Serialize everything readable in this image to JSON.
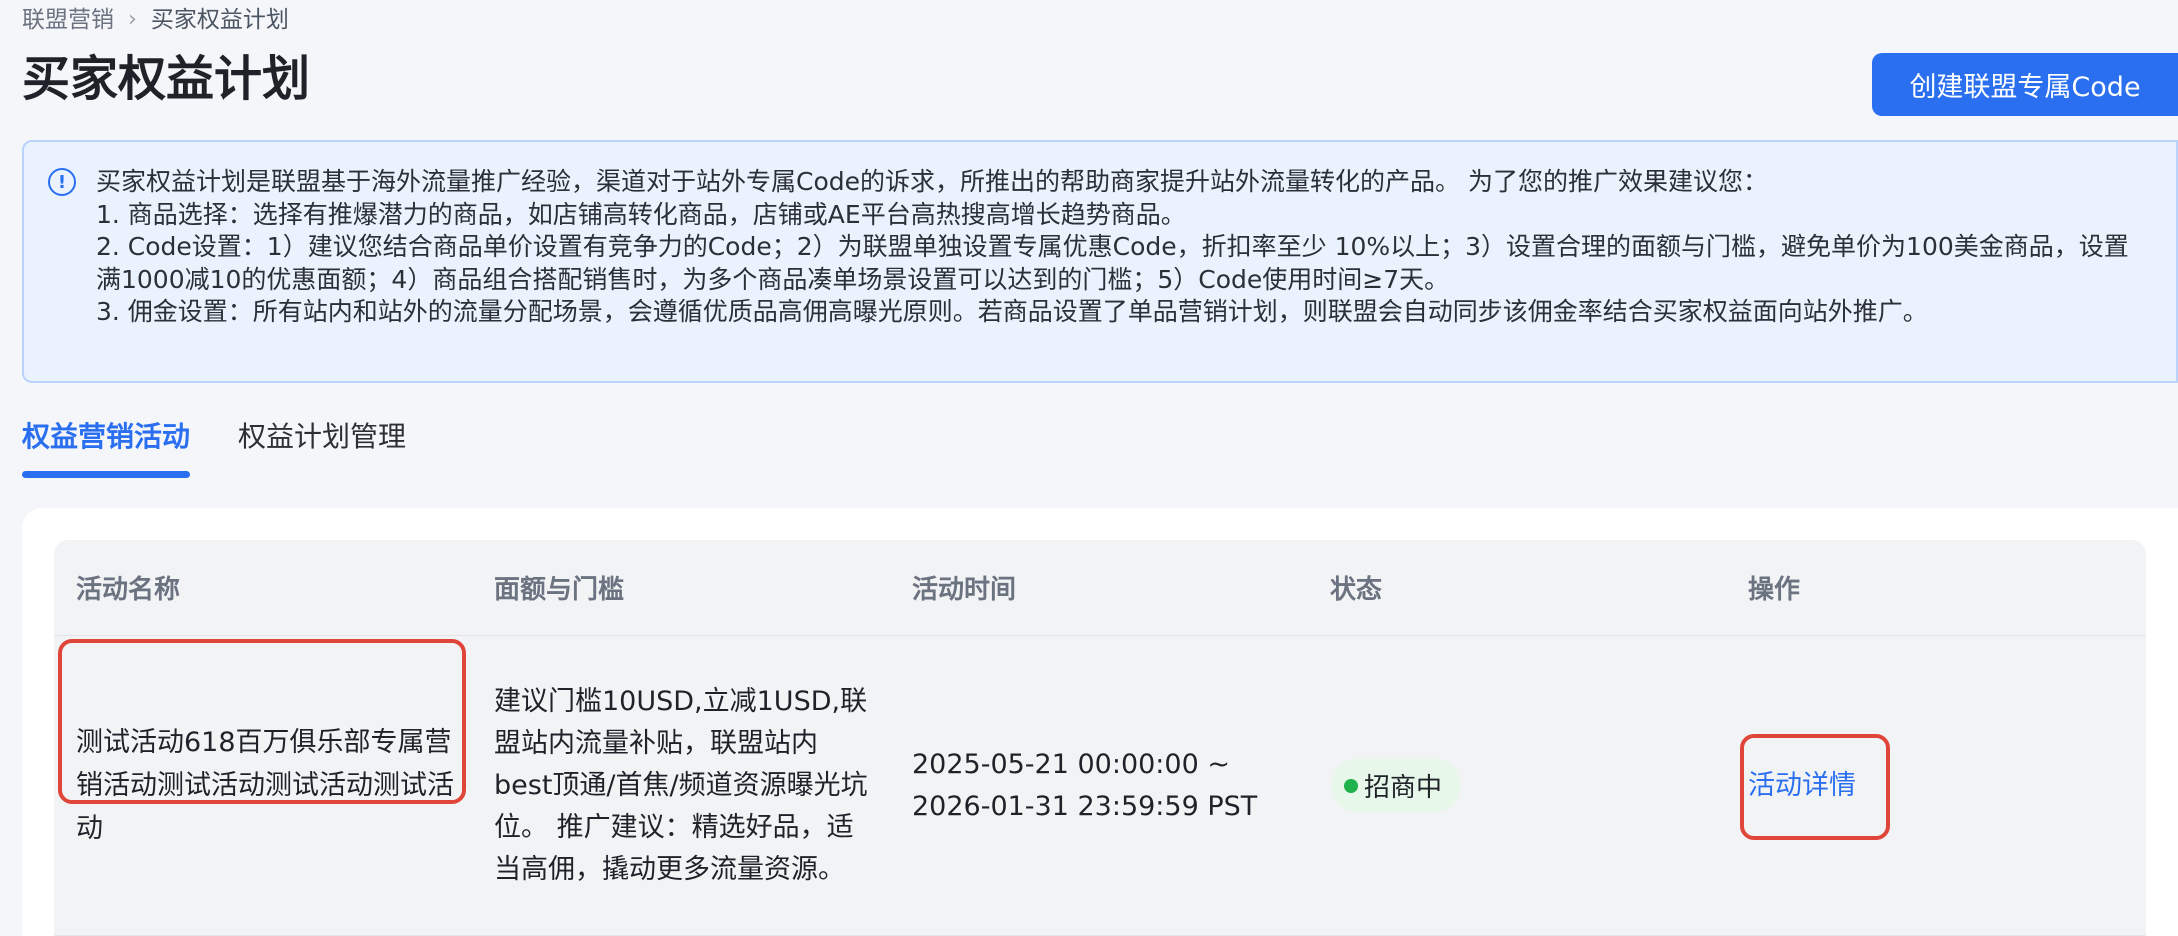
{
  "breadcrumb": {
    "parent": "联盟营销",
    "separator": "›",
    "current": "买家权益计划"
  },
  "header": {
    "title": "买家权益计划",
    "create_button": "创建联盟专属Code"
  },
  "alert": {
    "icon": "info-icon",
    "lines": [
      "买家权益计划是联盟基于海外流量推广经验，渠道对于站外专属Code的诉求，所推出的帮助商家提升站外流量转化的产品。 为了您的推广效果建议您：",
      "1. 商品选择：选择有推爆潜力的商品，如店铺高转化商品，店铺或AE平台高热搜高增长趋势商品。",
      "2. Code设置：1）建议您结合商品单价设置有竞争力的Code；2）为联盟单独设置专属优惠Code，折扣率至少 10%以上；3）设置合理的面额与门槛，避免单价为100美金商品，设置满1000减10的优惠面额；4）商品组合搭配销售时，为多个商品凑单场景设置可以达到的门槛；5）Code使用时间≥7天。",
      "3. 佣金设置：所有站内和站外的流量分配场景，会遵循优质品高佣高曝光原则。若商品设置了单品营销计划，则联盟会自动同步该佣金率结合买家权益面向站外推广。"
    ]
  },
  "tabs": [
    {
      "label": "权益营销活动",
      "active": true
    },
    {
      "label": "权益计划管理",
      "active": false
    }
  ],
  "table": {
    "columns": [
      "活动名称",
      "面额与门槛",
      "活动时间",
      "状态",
      "操作"
    ],
    "rows": [
      {
        "name": "测试活动618百万俱乐部专属营销活动测试活动测试活动测试活动",
        "threshold": "建议门槛10USD,立减1USD,联盟站内流量补贴，联盟站内best顶通/首焦/频道资源曝光坑位。 推广建议：精选好品，适当高佣，撬动更多流量资源。",
        "time_start": "2025-05-21 00:00:00 ~",
        "time_end": "2026-01-31 23:59:59 PST",
        "status": "招商中",
        "action": "活动详情"
      }
    ]
  },
  "colors": {
    "accent": "#2a6ff0",
    "status_green": "#1fb14b",
    "status_bg": "#e7f7e9",
    "highlight_red": "#e0453a",
    "alert_bg": "#eaf2fe"
  }
}
